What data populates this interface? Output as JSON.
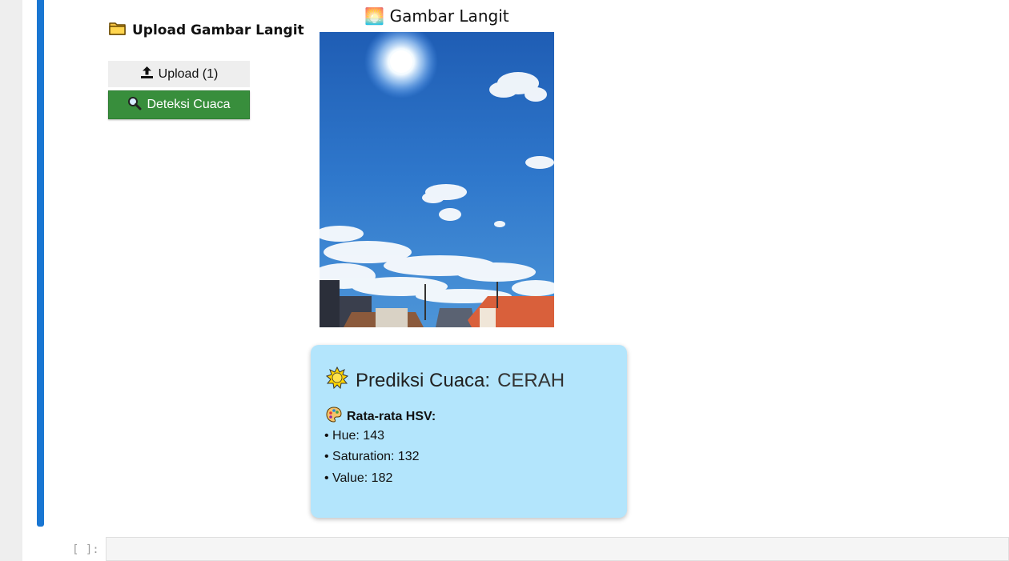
{
  "upload_section": {
    "heading": "Upload Gambar Langit",
    "icon": "folder-icon",
    "upload_button_label": "Upload (1)",
    "detect_button_label": "Deteksi Cuaca"
  },
  "image_panel": {
    "title": "🌅 Gambar Langit"
  },
  "result": {
    "prediction_label": "Prediksi Cuaca:",
    "prediction_value": "CERAH",
    "hsv_heading": "Rata-rata HSV:",
    "hue": "• Hue: 143",
    "saturation": "• Saturation: 132",
    "value": "• Value: 182",
    "card_color": "#b3e5fc"
  },
  "next_cell": {
    "prompt": "[ ]:"
  },
  "colors": {
    "cell_bar": "#1976d2",
    "detect_button": "#388e3c"
  }
}
